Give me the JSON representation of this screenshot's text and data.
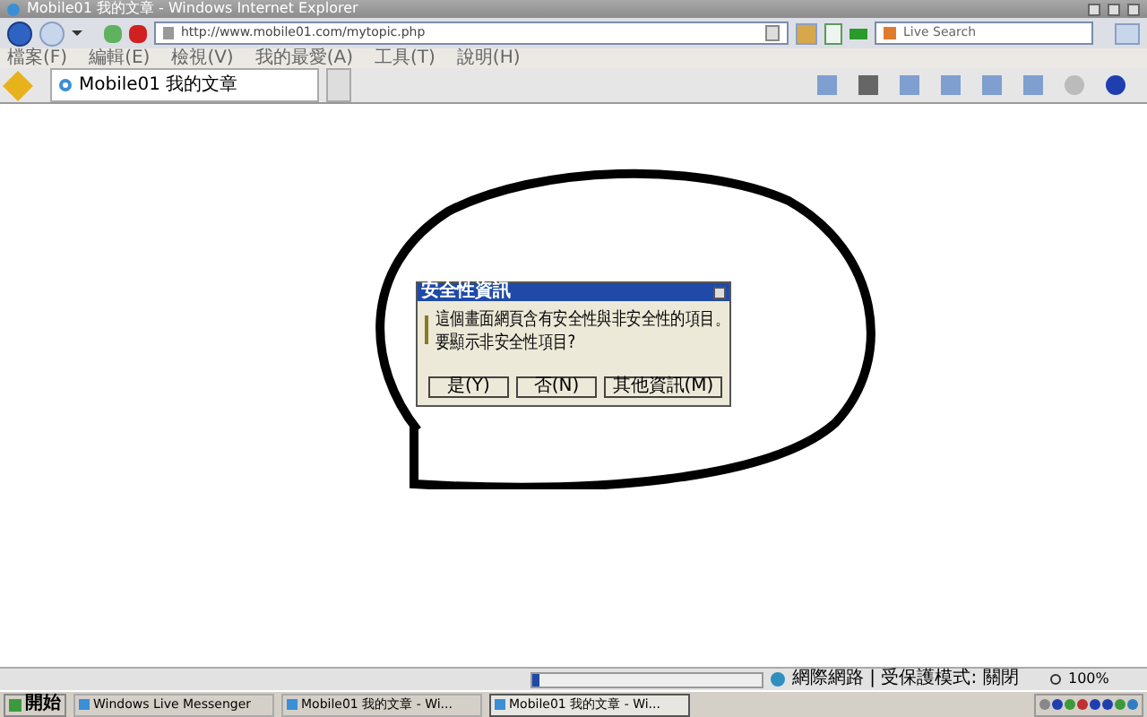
{
  "window": {
    "title": "Mobile01 我的文章 - Windows Internet Explorer"
  },
  "address_bar": {
    "url": "http://www.mobile01.com/mytopic.php"
  },
  "search": {
    "placeholder": "Live Search"
  },
  "menu": [
    "檔案(F)",
    "編輯(E)",
    "檢視(V)",
    "我的最愛(A)",
    "工具(T)",
    "說明(H)"
  ],
  "tabs": [
    {
      "label": "Mobile01 我的文章",
      "selected": true
    }
  ],
  "dialog": {
    "title": "安全性資訊",
    "message": [
      "這個畫面網頁含有安全性與非安全性的項目。",
      "要顯示非安全性項目?"
    ],
    "buttons": [
      "是(Y)",
      "否(N)",
      "其他資訊(M)"
    ]
  },
  "status_bar": {
    "progress": {
      "level": 0.03
    },
    "zone": "網際網路 | 受保護模式: 關閉",
    "zoom": "100%"
  },
  "taskbar": {
    "start": "開始",
    "tasks": [
      {
        "label": "Windows Live Messenger",
        "selected": false
      },
      {
        "label": "Mobile01 我的文章 - Wi...",
        "selected": false
      },
      {
        "label": "Mobile01 我的文章 - Wi...",
        "selected": true
      }
    ]
  }
}
